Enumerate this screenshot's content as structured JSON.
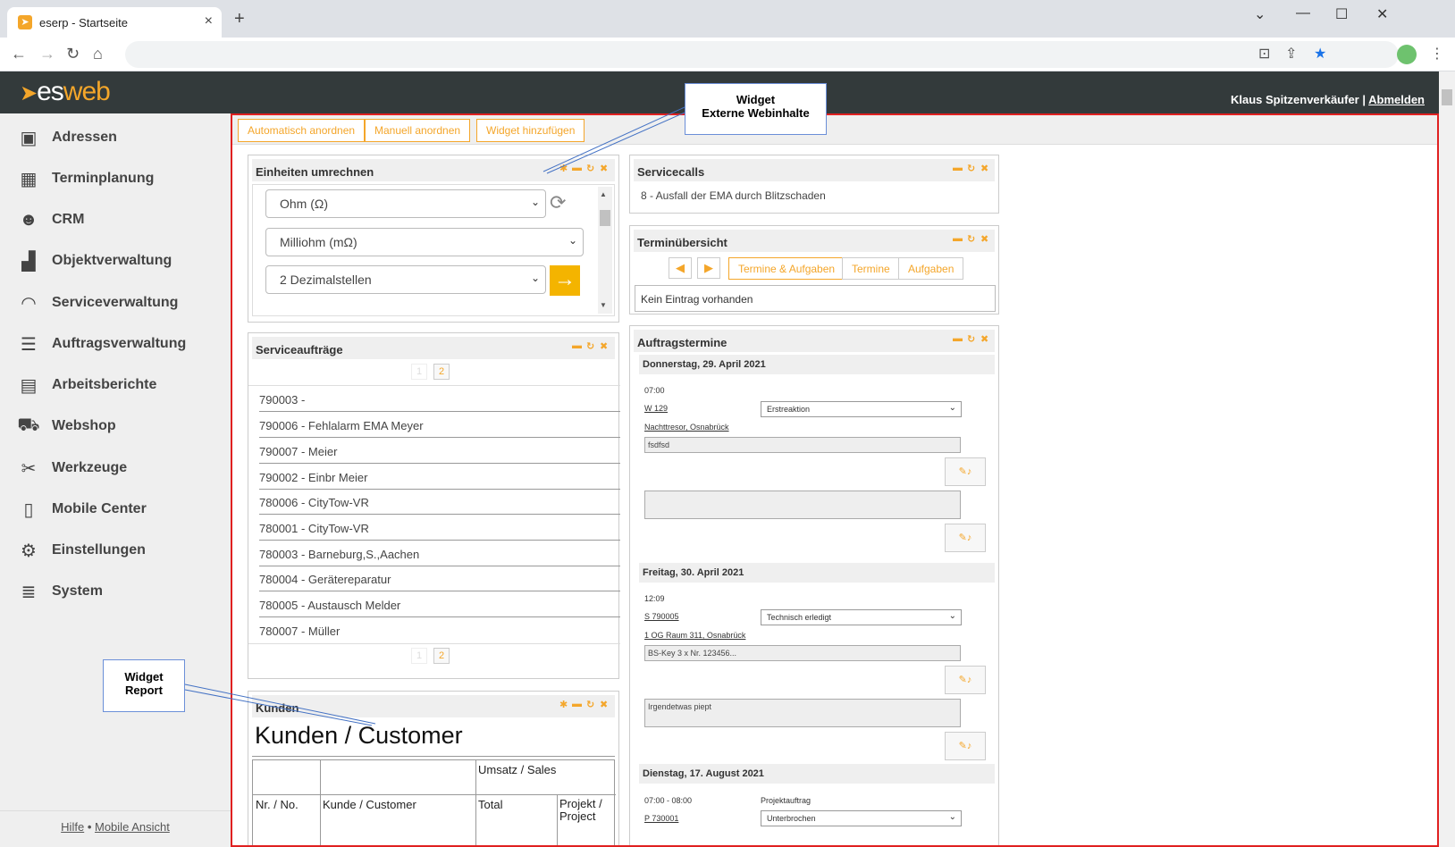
{
  "browser": {
    "tab_title": "eserp - Startseite",
    "tab_favicon": "esweb-favicon",
    "new_tab_icon": "+",
    "tab_close_icon": "×"
  },
  "app": {
    "logo_text": "es",
    "logo_web": "web",
    "user_name": "Klaus Spitzenverkäufer",
    "separator": "|",
    "logout_label": "Abmelden"
  },
  "sidebar": {
    "items": [
      {
        "label": "Adressen",
        "icon": "address-book-icon"
      },
      {
        "label": "Terminplanung",
        "icon": "calendar-icon"
      },
      {
        "label": "CRM",
        "icon": "users-icon"
      },
      {
        "label": "Objektverwaltung",
        "icon": "factory-icon"
      },
      {
        "label": "Serviceverwaltung",
        "icon": "headset-icon"
      },
      {
        "label": "Auftragsverwaltung",
        "icon": "list-icon"
      },
      {
        "label": "Arbeitsberichte",
        "icon": "clipboard-icon"
      },
      {
        "label": "Webshop",
        "icon": "cart-icon"
      },
      {
        "label": "Werkzeuge",
        "icon": "tools-icon"
      },
      {
        "label": "Mobile Center",
        "icon": "mobile-icon"
      },
      {
        "label": "Einstellungen",
        "icon": "gears-icon"
      },
      {
        "label": "System",
        "icon": "database-icon"
      }
    ],
    "footer_help": "Hilfe",
    "footer_sep": "•",
    "footer_mobile": "Mobile Ansicht"
  },
  "toolbar": {
    "auto_arrange": "Automatisch anordnen",
    "manual_arrange": "Manuell anordnen",
    "add_widget": "Widget hinzufügen"
  },
  "units_widget": {
    "title": "Einheiten umrechnen",
    "from_unit": "Ohm (Ω)",
    "to_unit": "Milliohm (mΩ)",
    "decimals": "2 Dezimalstellen"
  },
  "service_orders": {
    "title": "Serviceaufträge",
    "page_current": "1",
    "page_next": "2",
    "items": [
      "790003 -",
      "790006 - Fehlalarm EMA Meyer",
      "790007 - Meier",
      "790002 - Einbr Meier",
      "780006 - CityTow-VR",
      "780001 - CityTow-VR",
      "780003 - Barneburg,S.,Aachen",
      "780004 - Gerätereparatur",
      "780005 - Austausch Melder",
      "780007 - Müller"
    ]
  },
  "customers_widget": {
    "title": "Kunden",
    "report_title": "Kunden / Customer",
    "col_sales": "Umsatz / Sales",
    "col_no": "Nr. / No.",
    "col_customer": "Kunde / Customer",
    "col_total": "Total",
    "col_project": "Projekt / Project"
  },
  "servicecalls": {
    "title": "Servicecalls",
    "item": "8 - Ausfall der EMA durch Blitzschaden"
  },
  "appointments_overview": {
    "title": "Terminübersicht",
    "tabs": [
      "Termine & Aufgaben",
      "Termine",
      "Aufgaben"
    ],
    "empty": "Kein Eintrag vorhanden"
  },
  "order_appointments": {
    "title": "Auftragstermine",
    "days": [
      {
        "date": "Donnerstag, 29. April 2021",
        "time": "07:00",
        "ref": "W 129",
        "status": "Erstreaktion",
        "location": "Nachttresor, Osnabrück",
        "note1": "fsdfsd",
        "note2": ""
      },
      {
        "date": "Freitag, 30. April 2021",
        "time": "12:09",
        "ref": "S 790005",
        "status": "Technisch erledigt",
        "location": "1 OG Raum 311, Osnabrück",
        "note1": "BS-Key 3 x Nr. 123456...",
        "note2": "Irgendetwas piept"
      },
      {
        "date": "Dienstag, 17. August 2021",
        "time": "07:00 - 08:00",
        "kind": "Projektauftrag",
        "ref": "P 730001",
        "status": "Unterbrochen"
      }
    ]
  },
  "callouts": {
    "web_line1": "Widget",
    "web_line2": "Externe Webinhalte",
    "report_line1": "Widget",
    "report_line2": "Report"
  }
}
